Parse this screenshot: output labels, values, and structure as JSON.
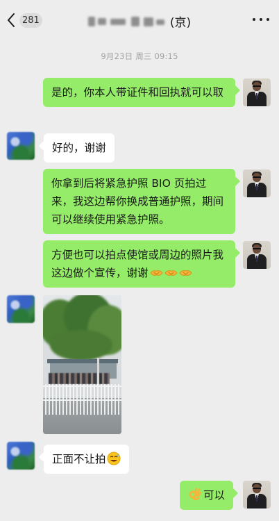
{
  "header": {
    "back_badge": "281",
    "title_suffix": "(京)"
  },
  "timestamp": "9月23日 周三 09:15",
  "messages": [
    {
      "sender": "me",
      "type": "text",
      "text": "是的，你本人带证件和回执就可以取"
    },
    {
      "sender": "other",
      "type": "text",
      "text": "好的，谢谢"
    },
    {
      "sender": "me",
      "type": "text",
      "text": "你拿到后将紧急护照 BIO 页拍过来，我这边帮你换成普通护照，期间可以继续使用紧急护照。"
    },
    {
      "sender": "me",
      "type": "text",
      "text": "方便也可以拍点使馆或周边的照片我这边做个宣传，谢谢",
      "emoji": [
        "handshake-emoji",
        "handshake-emoji",
        "handshake-emoji"
      ]
    },
    {
      "sender": "other",
      "type": "image",
      "description_icon": "photo-street-scene"
    },
    {
      "sender": "other",
      "type": "text",
      "text": "正面不让拍",
      "emoji": [
        "sweat-smile-emoji"
      ]
    },
    {
      "sender": "me",
      "type": "text",
      "text": "可以",
      "emoji_before": [
        "ok-hand-emoji"
      ]
    }
  ],
  "colors": {
    "background": "#ededed",
    "bubble_me": "#95ec69",
    "bubble_other": "#ffffff",
    "timestamp": "#a2a2a2"
  }
}
